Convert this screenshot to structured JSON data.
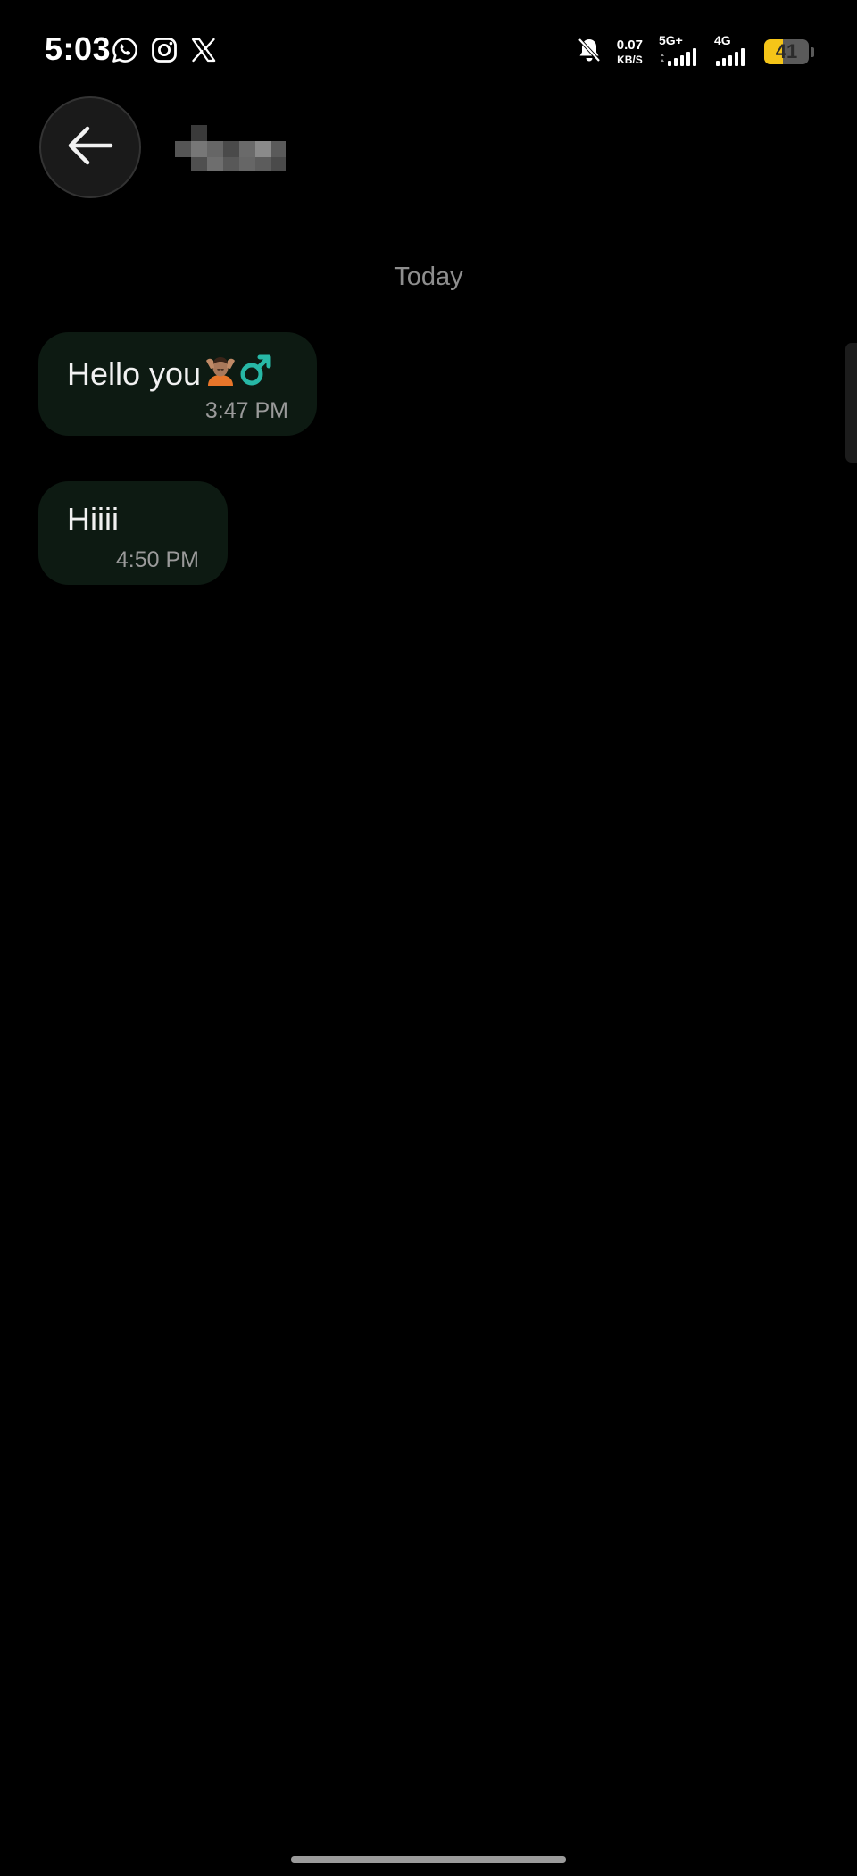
{
  "status_bar": {
    "time": "5:03",
    "app_icons": [
      "whatsapp-icon",
      "instagram-icon",
      "x-icon"
    ],
    "bell_icon": "bell-off-icon",
    "net_speed_value": "0.07",
    "net_speed_unit": "KB/S",
    "sim1_label": "5G+",
    "sim2_label": "4G",
    "battery_level": "41",
    "battery_color": "#f5c518"
  },
  "header": {
    "back_icon": "arrow-left-icon",
    "contact_name_state": "pixelated"
  },
  "conversation": {
    "date_divider": "Today",
    "bubble_color": "#0d1a12",
    "messages": [
      {
        "text": "Hello you",
        "emoji": [
          "person-getting-massage-emoji",
          "male-sign-emoji"
        ],
        "time": "3:47 PM"
      },
      {
        "text": "Hiiii",
        "time": "4:50 PM"
      }
    ]
  }
}
